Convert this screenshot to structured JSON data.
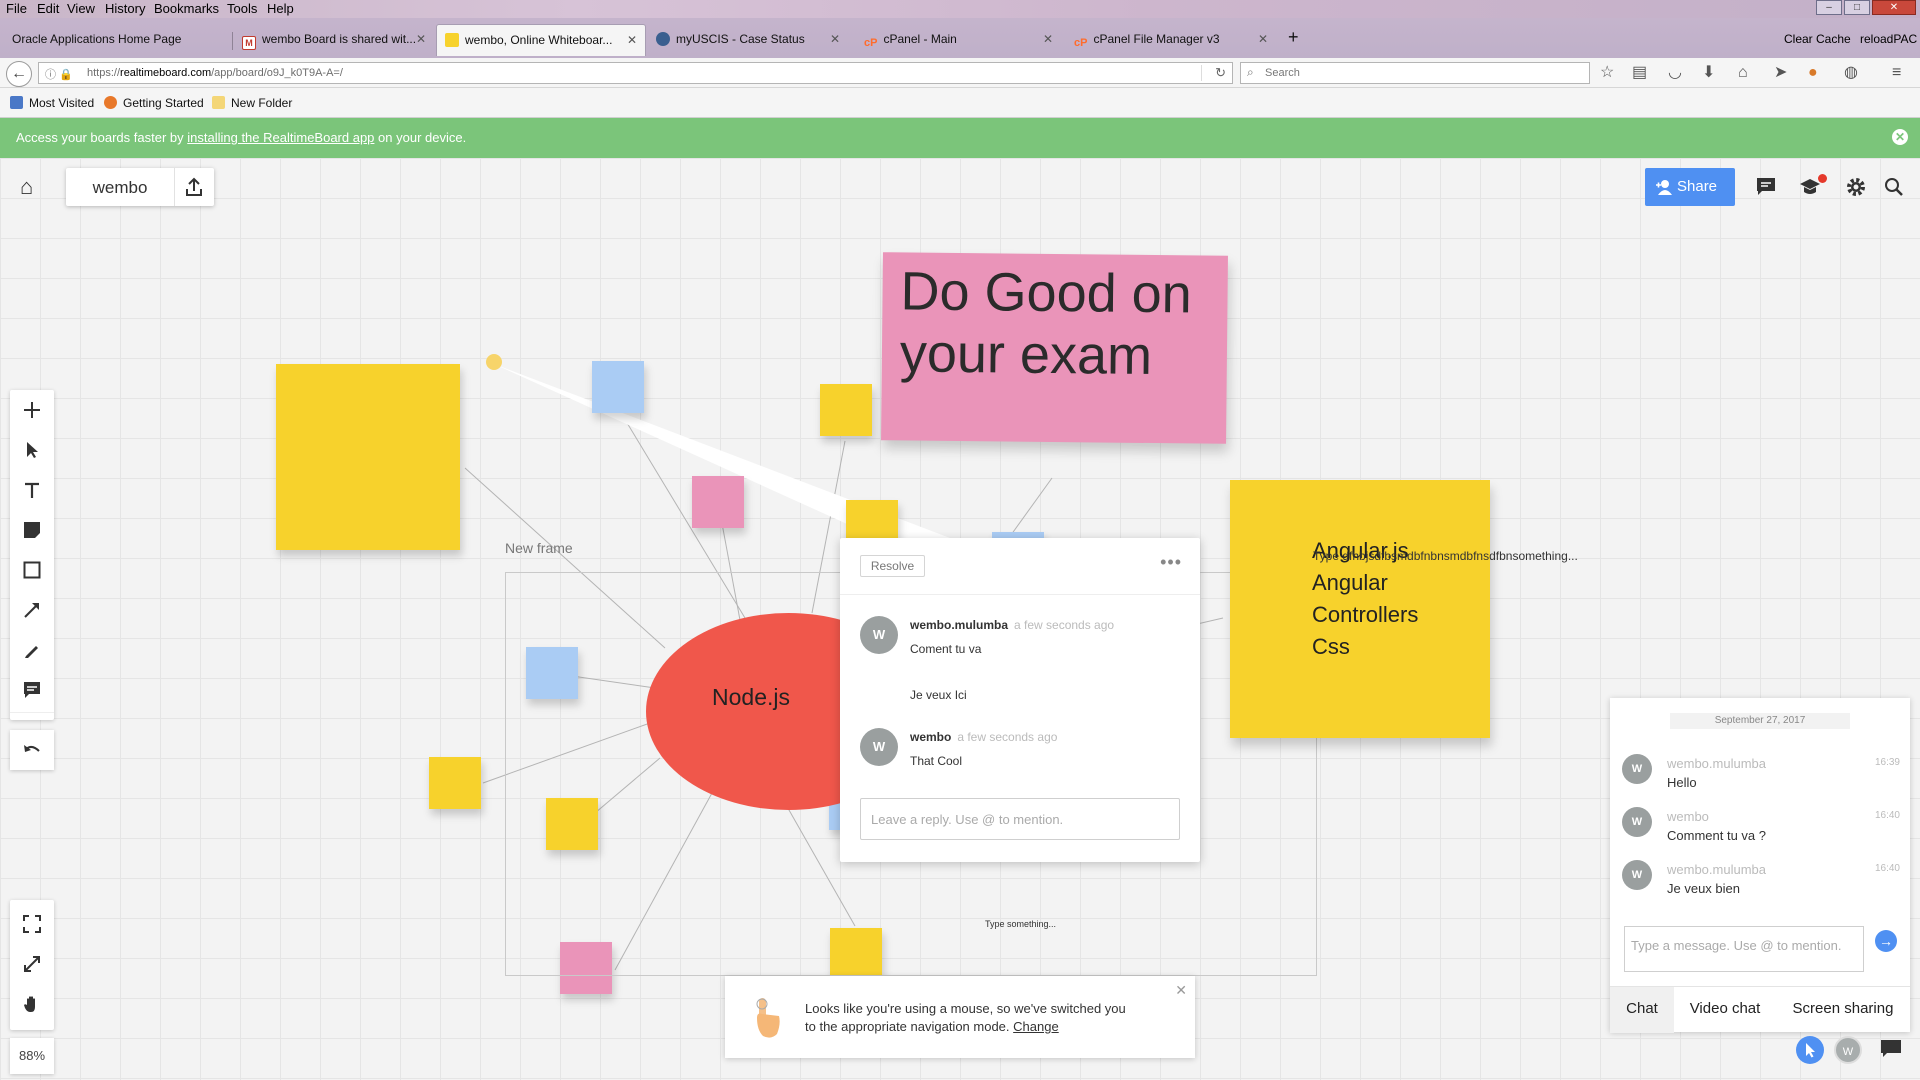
{
  "browser": {
    "menu": [
      "File",
      "Edit",
      "View",
      "History",
      "Bookmarks",
      "Tools",
      "Help"
    ],
    "tabs": [
      {
        "label": "Oracle Applications Home Page",
        "favicon_color": "#d33b2c"
      },
      {
        "label": "wembo Board is shared wit...",
        "favicon_color": "#c23b2f"
      },
      {
        "label": "wembo, Online Whiteboar...",
        "favicon_color": "#f7d22c"
      },
      {
        "label": "myUSCIS - Case Status",
        "favicon_color": "#3a5f8f"
      },
      {
        "label": "cPanel - Main",
        "favicon_color": "#ff6c2c"
      },
      {
        "label": "cPanel File Manager v3",
        "favicon_color": "#ff6c2c"
      }
    ],
    "toolbar_right": [
      "Clear Cache",
      "reloadPAC"
    ],
    "url": {
      "prefix": "https://",
      "host": "realtimeboard.com",
      "path": "/app/board/o9J_k0T9A-A=/"
    },
    "search_placeholder": "Search",
    "bookmarks": [
      "Most Visited",
      "Getting Started",
      "New Folder"
    ]
  },
  "notice": {
    "before": "Access your boards faster by ",
    "link": "installing the RealtimeBoard app",
    "after": " on your device."
  },
  "board": {
    "name": "wembo",
    "share_label": "Share",
    "zoom": "88%",
    "frame_label": "New frame",
    "center_node": "Node.js",
    "title_note": [
      "Do Good on",
      "your exam"
    ],
    "angular_note": [
      "Angular.js",
      "Angular",
      "Controllers",
      "Css"
    ],
    "overflow_text": "Type dfhbjsdfbsmdbfnbnsmdbfnsdfbnsomething...",
    "type_something": "Type something..."
  },
  "comment_popup": {
    "resolve_label": "Resolve",
    "menu": "•••",
    "comments": [
      {
        "avatar": "W",
        "author": "wembo.mulumba",
        "time": "a few seconds ago",
        "lines": [
          "Coment tu va",
          "Je veux Ici"
        ]
      },
      {
        "avatar": "W",
        "author": "wembo",
        "time": "a few seconds ago",
        "lines": [
          "That Cool"
        ]
      }
    ],
    "reply_placeholder": "Leave a reply. Use @ to mention."
  },
  "chat": {
    "date": "September 27, 2017",
    "messages": [
      {
        "avatar": "W",
        "name": "wembo.mulumba",
        "time": "16:39",
        "text": "Hello"
      },
      {
        "avatar": "W",
        "name": "wembo",
        "time": "16:40",
        "text": "Comment tu va ?"
      },
      {
        "avatar": "W",
        "name": "wembo.mulumba",
        "time": "16:40",
        "text": "Je veux bien"
      }
    ],
    "input_placeholder": "Type a message. Use @ to mention.",
    "tabs": [
      "Chat",
      "Video chat",
      "Screen sharing"
    ]
  },
  "mouse_notice": {
    "text": "Looks like you're using a mouse, so we've switched you to the appropriate navigation mode.",
    "link": "Change"
  },
  "user_avatar": "W",
  "colors": {
    "yellow": "#f7d22c",
    "blue": "#aaccf4",
    "pink": "#ea94b9",
    "red": "#f0574b",
    "green_banner": "#7bc57a",
    "accent": "#4f90f2"
  }
}
